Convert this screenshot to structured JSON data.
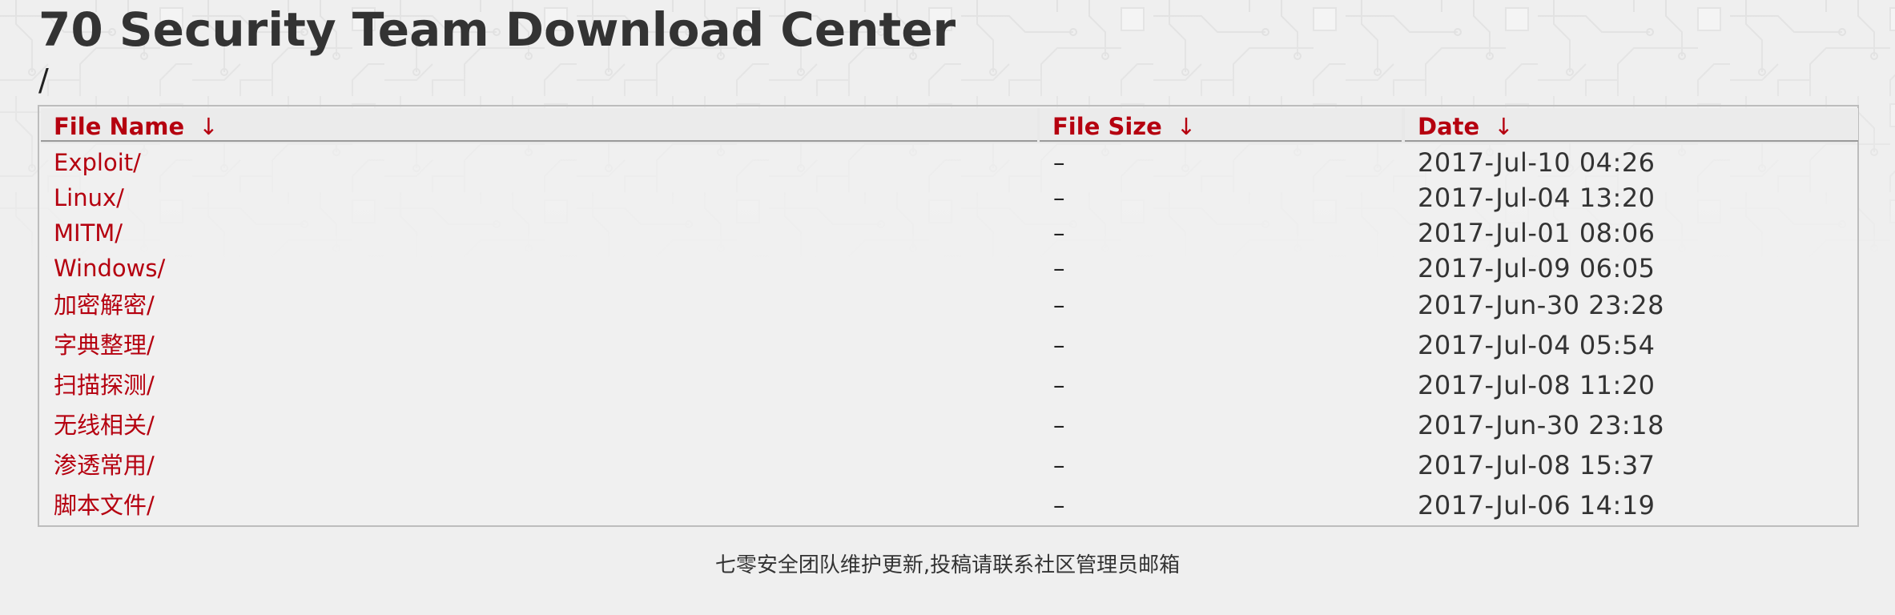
{
  "page": {
    "title": "70 Security Team Download Center",
    "breadcrumb": "/"
  },
  "table": {
    "columns": [
      {
        "label": "File Name",
        "sort_icon": "arrow-down-icon"
      },
      {
        "label": "File Size",
        "sort_icon": "arrow-down-icon"
      },
      {
        "label": "Date",
        "sort_icon": "arrow-down-icon"
      }
    ],
    "sort_arrow": "↓",
    "rows": [
      {
        "name": "Exploit/",
        "size": "–",
        "date": "2017-Jul-10 04:26"
      },
      {
        "name": "Linux/",
        "size": "–",
        "date": "2017-Jul-04 13:20"
      },
      {
        "name": "MITM/",
        "size": "–",
        "date": "2017-Jul-01 08:06"
      },
      {
        "name": "Windows/",
        "size": "–",
        "date": "2017-Jul-09 06:05"
      },
      {
        "name": "加密解密/",
        "size": "–",
        "date": "2017-Jun-30 23:28"
      },
      {
        "name": "字典整理/",
        "size": "–",
        "date": "2017-Jul-04 05:54"
      },
      {
        "name": "扫描探测/",
        "size": "–",
        "date": "2017-Jul-08 11:20"
      },
      {
        "name": "无线相关/",
        "size": "–",
        "date": "2017-Jun-30 23:18"
      },
      {
        "name": "渗透常用/",
        "size": "–",
        "date": "2017-Jul-08 15:37"
      },
      {
        "name": "脚本文件/",
        "size": "–",
        "date": "2017-Jul-06 14:19"
      }
    ]
  },
  "footer": {
    "text": "七零安全团队维护更新,投稿请联系社区管理员邮箱"
  },
  "colors": {
    "link": "#b5000f",
    "text": "#333333",
    "background": "#efefef",
    "border": "#bdbdbd"
  }
}
